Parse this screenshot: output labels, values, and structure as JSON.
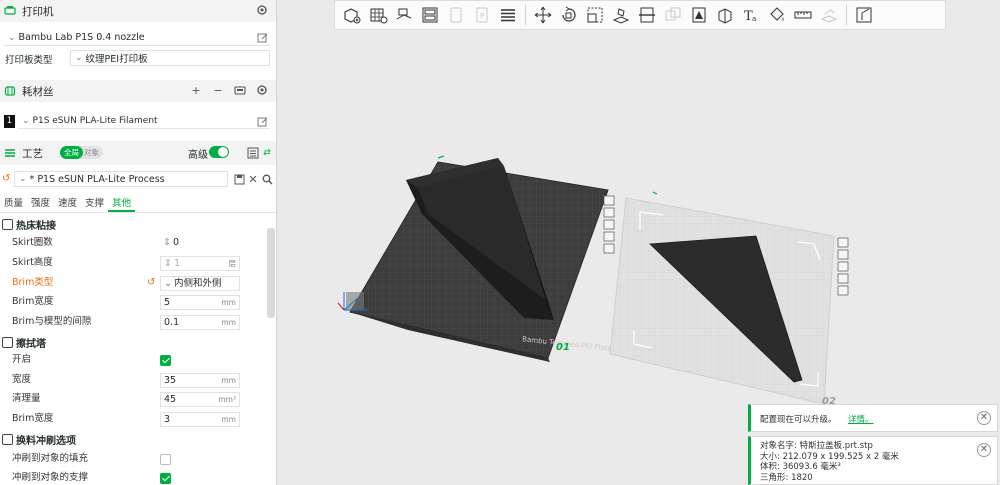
{
  "printer": {
    "title": "打印机",
    "preset": "Bambu Lab P1S 0.4 nozzle",
    "plate_label": "打印板类型",
    "plate_value": "纹理PEI打印板"
  },
  "filament": {
    "title": "耗材丝",
    "slot_number": "1",
    "name": "P1S eSUN PLA-Lite Filament"
  },
  "process": {
    "title": "工艺",
    "toggle_global": "全局",
    "toggle_object": "对象",
    "advanced_label": "高级",
    "preset": "* P1S eSUN PLA-Lite Process",
    "tabs": [
      "质量",
      "强度",
      "速度",
      "支撑",
      "其他"
    ],
    "active_tab": 4
  },
  "groups": {
    "bed_adhesion": "热床粘接",
    "prime_tower": "擦拭塔",
    "flush_options": "换料冲刷选项"
  },
  "options": {
    "skirt_loops": {
      "label": "Skirt圈数",
      "value": "0"
    },
    "skirt_height": {
      "label": "Skirt高度",
      "value": "1",
      "unit": "层"
    },
    "brim_type": {
      "label": "Brim类型",
      "value": "内侧和外侧"
    },
    "brim_width": {
      "label": "Brim宽度",
      "value": "5",
      "unit": "mm"
    },
    "brim_gap": {
      "label": "Brim与模型的间隙",
      "value": "0.1",
      "unit": "mm"
    },
    "enable": {
      "label": "开启",
      "checked": true
    },
    "width": {
      "label": "宽度",
      "value": "35",
      "unit": "mm"
    },
    "prime_volume": {
      "label": "清理量",
      "value": "45",
      "unit": "mm³"
    },
    "tower_brim_width": {
      "label": "Brim宽度",
      "value": "3",
      "unit": "mm"
    },
    "flush_infill": {
      "label": "冲刷到对象的填充",
      "checked": false
    },
    "flush_support": {
      "label": "冲刷到对象的支撑",
      "checked": true
    }
  },
  "plates": {
    "plate1_number": "01",
    "plate2_number": "02",
    "plate_brand": "Bambu Textured PEI Plate"
  },
  "notifications": {
    "upgrade_text": "配置现在可以升级。",
    "upgrade_link": "详情。",
    "object_name_label": "对象名字:",
    "object_name": "特斯拉盖板.prt.stp",
    "size_label": "大小:",
    "size": "212.079 x 199.525 x 2 毫米",
    "volume_label": "体积:",
    "volume": "36093.6 毫米³",
    "triangles_label": "三角形:",
    "triangles": "1820"
  },
  "colors": {
    "accent": "#00ae42",
    "orange": "#e8711f",
    "plate_dark": "#3a3a3a",
    "model": "#1b1b1b"
  },
  "icons": [
    "printer-icon",
    "gear-icon",
    "edit-icon",
    "filament-icon",
    "plus-icon",
    "minus-icon",
    "sync-icon",
    "process-icon",
    "list-icon",
    "save-icon",
    "close-icon",
    "search-icon"
  ]
}
